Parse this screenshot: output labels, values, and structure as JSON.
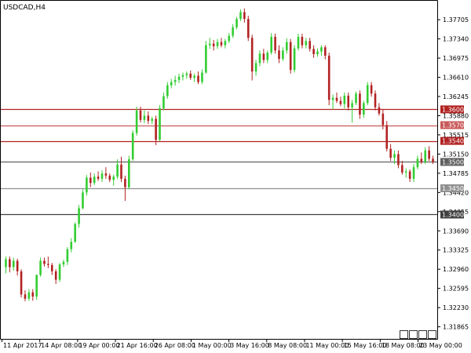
{
  "window_title": "USDCAD,H4",
  "chart_data": {
    "type": "candlestick",
    "symbol": "USDCAD",
    "timeframe": "H4",
    "ylim": [
      1.3165,
      1.3805
    ],
    "y_ticks": [
      "1.37705",
      "1.37340",
      "1.36975",
      "1.36610",
      "1.36245",
      "1.35880",
      "1.35515",
      "1.35150",
      "1.34785",
      "1.34420",
      "1.34055",
      "1.33690",
      "1.33325",
      "1.32960",
      "1.32595",
      "1.32230",
      "1.31865"
    ],
    "x_tick_labels": [
      "11 Apr 2017",
      "14 Apr 08:00",
      "19 Apr 00:00",
      "21 Apr 16:00",
      "26 Apr 08:00",
      "1 May 00:00",
      "3 May 16:00",
      "8 May 08:00",
      "11 May 00:00",
      "15 May 16:00",
      "18 May 08:00",
      "23 May 00:00"
    ],
    "horizontal_levels": [
      {
        "price": 1.36,
        "label": "1.36000",
        "color": "#b22222"
      },
      {
        "price": 1.357,
        "label": "1.35700",
        "color": "#c95a5a"
      },
      {
        "price": 1.354,
        "label": "1.35400",
        "color": "#b22222"
      },
      {
        "price": 1.35,
        "label": "1.35000",
        "color": "#606060"
      },
      {
        "price": 1.345,
        "label": "1.34500",
        "color": "#909090"
      },
      {
        "price": 1.34,
        "label": "1.34000",
        "color": "#404040"
      }
    ],
    "bull_color": "#32cd32",
    "bear_color": "#b22222",
    "candles": [
      [
        1.33,
        1.332,
        1.3288,
        1.3315
      ],
      [
        1.3315,
        1.332,
        1.329,
        1.33
      ],
      [
        1.33,
        1.3318,
        1.3293,
        1.3312
      ],
      [
        1.3312,
        1.3316,
        1.3284,
        1.3292
      ],
      [
        1.3292,
        1.3296,
        1.3242,
        1.3248
      ],
      [
        1.3248,
        1.3256,
        1.3235,
        1.324
      ],
      [
        1.324,
        1.3258,
        1.3236,
        1.3252
      ],
      [
        1.3252,
        1.3258,
        1.3236,
        1.3244
      ],
      [
        1.3244,
        1.3286,
        1.3238,
        1.3285
      ],
      [
        1.3285,
        1.3318,
        1.3282,
        1.3312
      ],
      [
        1.3312,
        1.3318,
        1.3301,
        1.3306
      ],
      [
        1.3306,
        1.332,
        1.3298,
        1.3304
      ],
      [
        1.3304,
        1.3308,
        1.3285,
        1.3292
      ],
      [
        1.3292,
        1.3296,
        1.3268,
        1.3276
      ],
      [
        1.3276,
        1.3308,
        1.3272,
        1.3305
      ],
      [
        1.3305,
        1.3314,
        1.33,
        1.331
      ],
      [
        1.331,
        1.3338,
        1.3304,
        1.3334
      ],
      [
        1.3334,
        1.3355,
        1.3328,
        1.3348
      ],
      [
        1.3348,
        1.3385,
        1.3346,
        1.3382
      ],
      [
        1.3382,
        1.3418,
        1.3375,
        1.3412
      ],
      [
        1.3412,
        1.3448,
        1.341,
        1.3442
      ],
      [
        1.3442,
        1.3475,
        1.3436,
        1.347
      ],
      [
        1.347,
        1.348,
        1.3452,
        1.346
      ],
      [
        1.346,
        1.3478,
        1.3456,
        1.3472
      ],
      [
        1.3472,
        1.3482,
        1.3464,
        1.3468
      ],
      [
        1.3468,
        1.3484,
        1.3462,
        1.3478
      ],
      [
        1.3478,
        1.349,
        1.3468,
        1.3474
      ],
      [
        1.3474,
        1.3478,
        1.3462,
        1.3466
      ],
      [
        1.3466,
        1.3476,
        1.3455,
        1.3472
      ],
      [
        1.3472,
        1.3505,
        1.3468,
        1.3495
      ],
      [
        1.3495,
        1.351,
        1.3462,
        1.3468
      ],
      [
        1.3468,
        1.3474,
        1.3426,
        1.3452
      ],
      [
        1.3452,
        1.3512,
        1.3448,
        1.3505
      ],
      [
        1.3505,
        1.356,
        1.3502,
        1.3555
      ],
      [
        1.3555,
        1.3605,
        1.355,
        1.3598
      ],
      [
        1.3598,
        1.3605,
        1.3575,
        1.358
      ],
      [
        1.358,
        1.3598,
        1.3574,
        1.3588
      ],
      [
        1.3588,
        1.3596,
        1.3572,
        1.3578
      ],
      [
        1.3578,
        1.3586,
        1.3572,
        1.3582
      ],
      [
        1.3582,
        1.3588,
        1.3532,
        1.3542
      ],
      [
        1.3542,
        1.3608,
        1.354,
        1.3602
      ],
      [
        1.3602,
        1.3632,
        1.3598,
        1.3625
      ],
      [
        1.3625,
        1.3652,
        1.362,
        1.3646
      ],
      [
        1.3646,
        1.3658,
        1.364,
        1.3652
      ],
      [
        1.3652,
        1.3664,
        1.3645,
        1.3656
      ],
      [
        1.3656,
        1.3668,
        1.365,
        1.3662
      ],
      [
        1.3662,
        1.367,
        1.3655,
        1.3665
      ],
      [
        1.3665,
        1.3672,
        1.3658,
        1.3668
      ],
      [
        1.3668,
        1.3674,
        1.3656,
        1.366
      ],
      [
        1.366,
        1.3668,
        1.3652,
        1.3664
      ],
      [
        1.3664,
        1.3672,
        1.3648,
        1.3652
      ],
      [
        1.3652,
        1.3676,
        1.3648,
        1.367
      ],
      [
        1.367,
        1.373,
        1.3668,
        1.3722
      ],
      [
        1.3722,
        1.3736,
        1.3715,
        1.3725
      ],
      [
        1.3725,
        1.3732,
        1.3712,
        1.372
      ],
      [
        1.372,
        1.3734,
        1.3715,
        1.3728
      ],
      [
        1.3728,
        1.3736,
        1.3718,
        1.3722
      ],
      [
        1.3722,
        1.3734,
        1.3716,
        1.373
      ],
      [
        1.373,
        1.3745,
        1.3726,
        1.374
      ],
      [
        1.374,
        1.3762,
        1.3736,
        1.3756
      ],
      [
        1.3756,
        1.3776,
        1.3752,
        1.3772
      ],
      [
        1.3772,
        1.379,
        1.3768,
        1.3785
      ],
      [
        1.3785,
        1.3792,
        1.3765,
        1.3772
      ],
      [
        1.3772,
        1.3778,
        1.373,
        1.3736
      ],
      [
        1.3736,
        1.3742,
        1.3655,
        1.3672
      ],
      [
        1.3672,
        1.3694,
        1.3664,
        1.3688
      ],
      [
        1.3688,
        1.3712,
        1.3682,
        1.3706
      ],
      [
        1.3706,
        1.3715,
        1.3688,
        1.3694
      ],
      [
        1.3694,
        1.3712,
        1.3688,
        1.3708
      ],
      [
        1.3708,
        1.3745,
        1.3704,
        1.3738
      ],
      [
        1.3738,
        1.3744,
        1.3706,
        1.3712
      ],
      [
        1.3712,
        1.3722,
        1.3688,
        1.3696
      ],
      [
        1.3696,
        1.3718,
        1.3692,
        1.3712
      ],
      [
        1.3712,
        1.3735,
        1.3706,
        1.3728
      ],
      [
        1.3728,
        1.3734,
        1.3668,
        1.3675
      ],
      [
        1.3675,
        1.3722,
        1.367,
        1.3716
      ],
      [
        1.3716,
        1.3744,
        1.3712,
        1.3738
      ],
      [
        1.3738,
        1.3744,
        1.3716,
        1.3722
      ],
      [
        1.3722,
        1.3736,
        1.3716,
        1.373
      ],
      [
        1.373,
        1.3736,
        1.371,
        1.3715
      ],
      [
        1.3715,
        1.3722,
        1.3698,
        1.3705
      ],
      [
        1.3705,
        1.3716,
        1.37,
        1.371
      ],
      [
        1.371,
        1.3722,
        1.3702,
        1.3718
      ],
      [
        1.3718,
        1.3722,
        1.3695,
        1.3702
      ],
      [
        1.3702,
        1.3708,
        1.3608,
        1.3618
      ],
      [
        1.3618,
        1.3628,
        1.36,
        1.3622
      ],
      [
        1.3622,
        1.3632,
        1.3612,
        1.3616
      ],
      [
        1.3616,
        1.3624,
        1.3606,
        1.361
      ],
      [
        1.361,
        1.3632,
        1.3602,
        1.3626
      ],
      [
        1.3626,
        1.3632,
        1.3598,
        1.3604
      ],
      [
        1.3604,
        1.3618,
        1.3575,
        1.3612
      ],
      [
        1.3612,
        1.3634,
        1.3608,
        1.363
      ],
      [
        1.363,
        1.3636,
        1.3582,
        1.359
      ],
      [
        1.359,
        1.3616,
        1.3584,
        1.3612
      ],
      [
        1.3612,
        1.3652,
        1.3608,
        1.3646
      ],
      [
        1.3646,
        1.3652,
        1.3624,
        1.363
      ],
      [
        1.363,
        1.3636,
        1.3598,
        1.3604
      ],
      [
        1.3604,
        1.3612,
        1.3588,
        1.3592
      ],
      [
        1.3592,
        1.36,
        1.3562,
        1.357
      ],
      [
        1.357,
        1.3578,
        1.352,
        1.3525
      ],
      [
        1.3525,
        1.3534,
        1.3502,
        1.3508
      ],
      [
        1.3508,
        1.3522,
        1.3496,
        1.3515
      ],
      [
        1.3515,
        1.3522,
        1.3488,
        1.3494
      ],
      [
        1.3494,
        1.3502,
        1.3476,
        1.348
      ],
      [
        1.348,
        1.3488,
        1.347,
        1.3482
      ],
      [
        1.3482,
        1.3486,
        1.3462,
        1.3468
      ],
      [
        1.3468,
        1.3496,
        1.3462,
        1.349
      ],
      [
        1.349,
        1.3512,
        1.3486,
        1.3506
      ],
      [
        1.3506,
        1.3518,
        1.3496,
        1.35
      ],
      [
        1.35,
        1.3528,
        1.3496,
        1.3522
      ],
      [
        1.3522,
        1.353,
        1.3502,
        1.3506
      ],
      [
        1.3506,
        1.3512,
        1.3496,
        1.35
      ]
    ]
  }
}
